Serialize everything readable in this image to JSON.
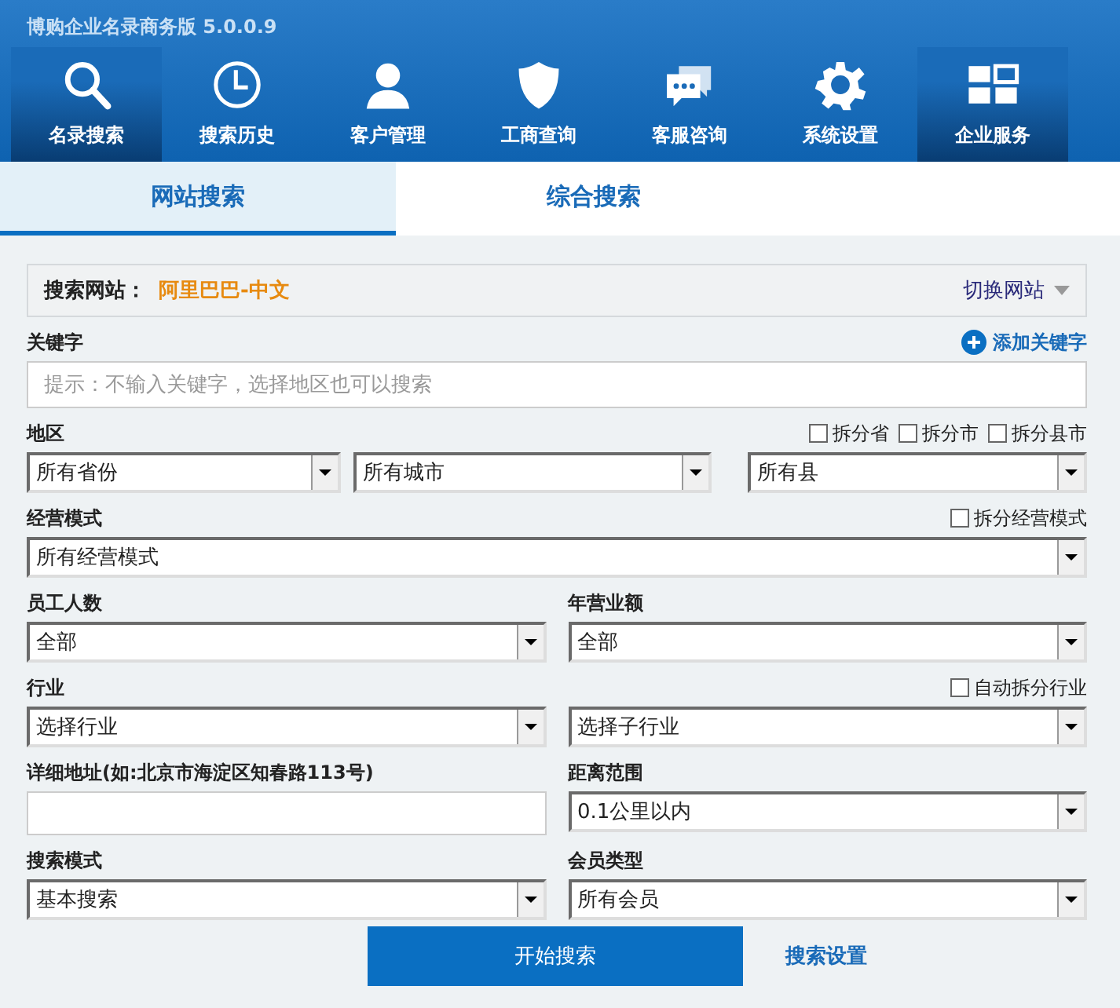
{
  "window": {
    "title": "博购企业名录商务版 5.0.0.9"
  },
  "nav": [
    {
      "label": "名录搜索",
      "selected": true
    },
    {
      "label": "搜索历史",
      "selected": false
    },
    {
      "label": "客户管理",
      "selected": false
    },
    {
      "label": "工商查询",
      "selected": false
    },
    {
      "label": "客服咨询",
      "selected": false
    },
    {
      "label": "系统设置",
      "selected": false
    },
    {
      "label": "企业服务",
      "selected": true
    }
  ],
  "tabs": [
    {
      "label": "网站搜索",
      "selected": true
    },
    {
      "label": "综合搜索",
      "selected": false
    }
  ],
  "site": {
    "label": "搜索网站：",
    "value": "阿里巴巴-中文",
    "switch": "切换网站"
  },
  "rows": [
    {
      "sections": [
        {
          "label": "关键字",
          "action": "添加关键字",
          "controls": [
            {
              "kind": "input",
              "placeholder": "提示：不输入关键字，选择地区也可以搜索"
            }
          ]
        }
      ]
    },
    {
      "sections": [
        {
          "label": "地区",
          "options": [
            {
              "label": "拆分省",
              "checked": false
            },
            {
              "label": "拆分市",
              "checked": false
            },
            {
              "label": "拆分县市",
              "checked": false
            }
          ],
          "controls": [
            {
              "kind": "select",
              "value": "所有省份"
            },
            {
              "kind": "select",
              "value": "所有城市"
            },
            {
              "kind": "select",
              "value": "所有县"
            }
          ]
        }
      ]
    },
    {
      "sections": [
        {
          "label": "经营模式",
          "options": [
            {
              "label": "拆分经营模式",
              "checked": false
            }
          ],
          "controls": [
            {
              "kind": "select",
              "value": "所有经营模式"
            }
          ]
        }
      ]
    },
    {
      "sections": [
        {
          "label": "员工人数",
          "controls": [
            {
              "kind": "select",
              "value": "全部"
            }
          ]
        },
        {
          "label": "年营业额",
          "controls": [
            {
              "kind": "select",
              "value": "全部"
            }
          ]
        }
      ]
    },
    {
      "sections": [
        {
          "label": "行业",
          "controls": [
            {
              "kind": "select",
              "value": "选择行业"
            }
          ]
        },
        {
          "options": [
            {
              "label": "自动拆分行业",
              "checked": false
            }
          ],
          "controls": [
            {
              "kind": "select",
              "value": "选择子行业"
            }
          ]
        }
      ]
    },
    {
      "sections": [
        {
          "label": "详细地址(如:北京市海淀区知春路113号)",
          "controls": [
            {
              "kind": "input"
            }
          ]
        },
        {
          "label": "距离范围",
          "controls": [
            {
              "kind": "select",
              "value": "0.1公里以内"
            }
          ]
        }
      ]
    },
    {
      "sections": [
        {
          "label": "搜索模式",
          "controls": [
            {
              "kind": "select",
              "value": "基本搜索"
            }
          ]
        },
        {
          "label": "会员类型",
          "controls": [
            {
              "kind": "select",
              "value": "所有会员"
            }
          ]
        }
      ]
    }
  ],
  "footer": {
    "start": "开始搜索",
    "settings": "搜索设置"
  }
}
